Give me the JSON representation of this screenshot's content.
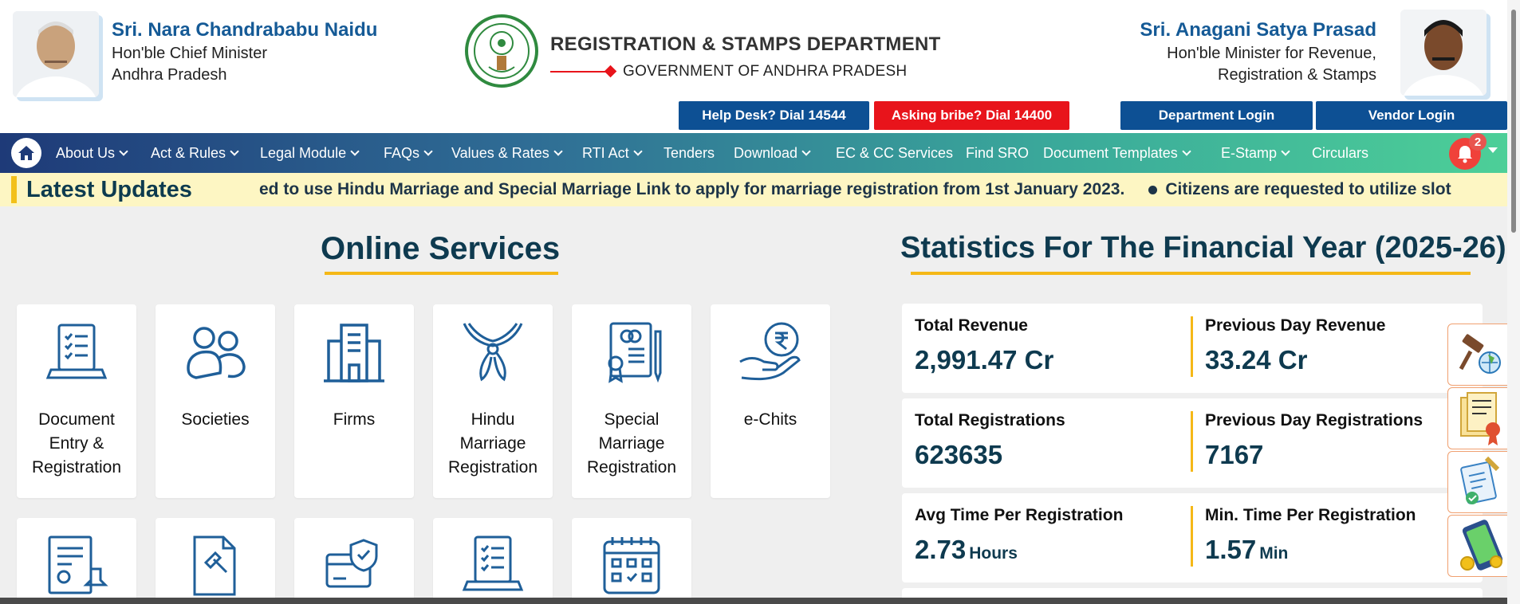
{
  "header": {
    "cm": {
      "name": "Sri. Nara Chandrababu Naidu",
      "line1": "Hon'ble Chief Minister",
      "line2": "Andhra Pradesh"
    },
    "dept_title": "REGISTRATION & STAMPS DEPARTMENT",
    "gov_title": "GOVERNMENT OF ANDHRA PRADESH",
    "minister": {
      "name": "Sri. Anagani Satya Prasad",
      "line1": "Hon'ble Minister for Revenue,",
      "line2": "Registration & Stamps"
    },
    "buttons": {
      "helpdesk": "Help Desk? Dial 14544",
      "bribe": "Asking bribe? Dial 14400",
      "dept_login": "Department Login",
      "vendor_login": "Vendor Login"
    }
  },
  "nav": {
    "items": [
      "About Us",
      "Act & Rules",
      "Legal Module",
      "FAQs",
      "Values & Rates",
      "RTI Act",
      "Tenders",
      "Download",
      "EC & CC Services",
      "Find SRO",
      "Document Templates",
      "E-Stamp",
      "Circulars"
    ],
    "notification_count": "2"
  },
  "updates": {
    "title": "Latest Updates",
    "ticker1": "ed to use Hindu Marriage and Special Marriage Link to apply for marriage registration from 1st January 2023.",
    "ticker2": "Citizens are requested to utilize slot"
  },
  "online_services": {
    "title": "Online Services",
    "cards": [
      {
        "label1": "Document",
        "label2": "Entry &",
        "label3": "Registration",
        "icon": "document-laptop-icon"
      },
      {
        "label1": "Societies",
        "label2": "",
        "label3": "",
        "icon": "people-icon"
      },
      {
        "label1": "Firms",
        "label2": "",
        "label3": "",
        "icon": "building-icon"
      },
      {
        "label1": "Hindu",
        "label2": "Marriage",
        "label3": "Registration",
        "icon": "garland-icon"
      },
      {
        "label1": "Special",
        "label2": "Marriage",
        "label3": "Registration",
        "icon": "certificate-rings-icon"
      },
      {
        "label1": "e-Chits",
        "label2": "",
        "label3": "",
        "icon": "rupee-hand-icon"
      }
    ]
  },
  "statistics": {
    "title": "Statistics For The Financial Year (2025-26)",
    "rows": [
      {
        "left_label": "Total Revenue",
        "left_value": "2,991.47 Cr",
        "right_label": "Previous Day Revenue",
        "right_value": "33.24 Cr"
      },
      {
        "left_label": "Total Registrations",
        "left_value": "623635",
        "right_label": "Previous Day Registrations",
        "right_value": "7167"
      },
      {
        "left_label": "Avg Time Per Registration",
        "left_value": "2.73",
        "left_unit": "Hours",
        "right_label": "Min. Time Per Registration",
        "right_value": "1.57",
        "right_unit": "Min"
      }
    ]
  },
  "colors": {
    "primary": "#0d5094",
    "accent": "#f5b817",
    "danger": "#e8141b"
  }
}
